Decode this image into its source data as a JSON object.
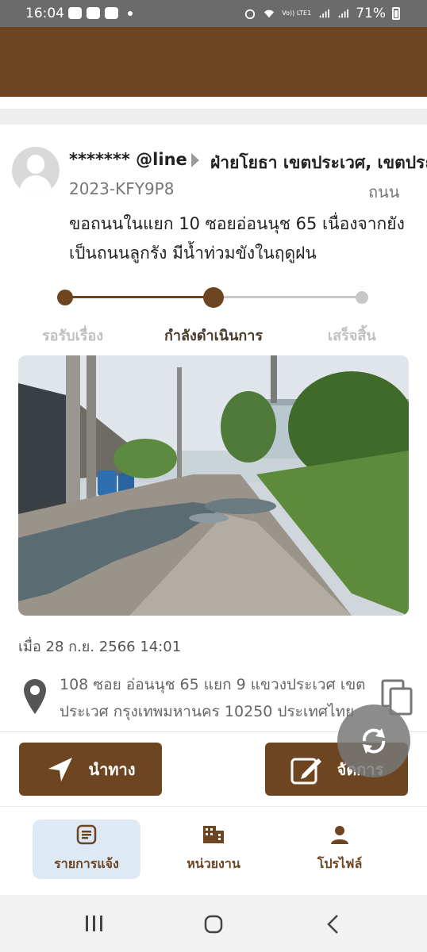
{
  "status_bar": {
    "time": "16:04",
    "battery": "71%",
    "network": "Vo)) LTE1"
  },
  "report": {
    "user": "******* @line",
    "agency": "ฝ่ายโยธา เขตประเวศ, เขตประเวศ",
    "ticket_id": "2023-KFY9P8",
    "category": "ถนน",
    "description": "ขอถนนในแยก 10 ซอยอ่อนนุช 65 เนื่องจากยังเป็นถนนลูกรัง มีน้ำท่วมขังในฤดูฝน",
    "progress": {
      "steps": [
        "รอรับเรื่อง",
        "กำลังดำเนินการ",
        "เสร็จสิ้น"
      ],
      "current_step": 1
    },
    "datetime": "เมื่อ 28 ก.ย. 2566 14:01",
    "address": "108 ซอย อ่อนนุช 65 แยก 9 แขวงประเวศ เขตประเวศ กรุงเทพมหานคร 10250 ประเทศไทย"
  },
  "actions": {
    "navigate_label": "นำทาง",
    "manage_label": "จัดการ"
  },
  "bottom_nav": {
    "items": [
      {
        "label": "รายการแจ้ง",
        "icon": "list-icon",
        "active": true
      },
      {
        "label": "หน่วยงาน",
        "icon": "building-icon",
        "active": false
      },
      {
        "label": "โปรไฟล์",
        "icon": "person-icon",
        "active": false
      }
    ]
  },
  "colors": {
    "brand": "#6e4521",
    "active_nav_bg": "#dde9f5",
    "progress_inactive": "#c8c8c8"
  }
}
